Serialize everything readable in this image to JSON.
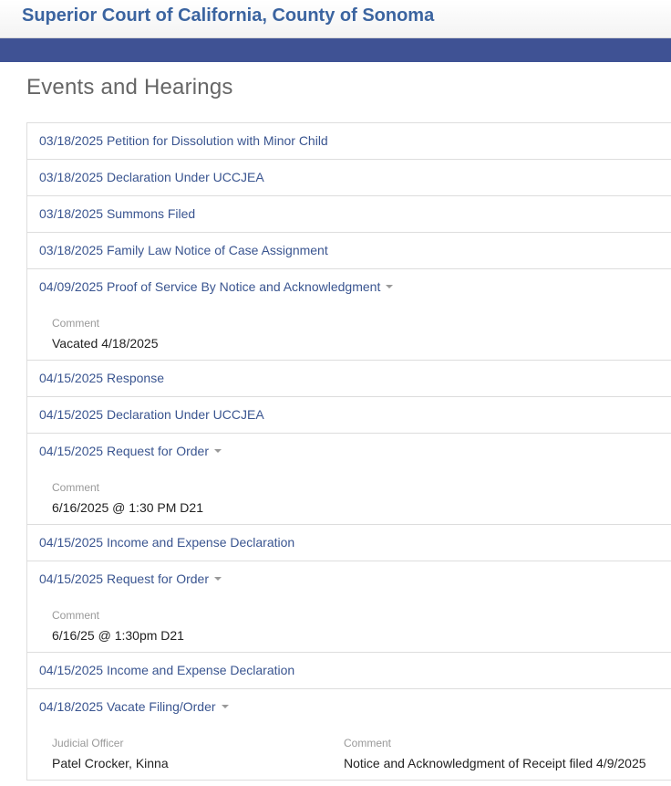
{
  "header": {
    "title": "Superior Court of California, County of Sonoma"
  },
  "page": {
    "title": "Events and Hearings"
  },
  "events": [
    {
      "label": "03/18/2025 Petition for Dissolution with Minor Child"
    },
    {
      "label": "03/18/2025 Declaration Under UCCJEA"
    },
    {
      "label": "03/18/2025 Summons Filed"
    },
    {
      "label": "03/18/2025 Family Law Notice of Case Assignment"
    },
    {
      "label": "04/09/2025 Proof of Service By Notice and Acknowledgment",
      "comment_label": "Comment",
      "comment": "Vacated 4/18/2025"
    },
    {
      "label": "04/15/2025 Response"
    },
    {
      "label": "04/15/2025 Declaration Under UCCJEA"
    },
    {
      "label": "04/15/2025 Request for Order",
      "comment_label": "Comment",
      "comment": "6/16/2025 @ 1:30 PM D21"
    },
    {
      "label": "04/15/2025 Income and Expense Declaration"
    },
    {
      "label": "04/15/2025 Request for Order",
      "comment_label": "Comment",
      "comment": "6/16/25 @ 1:30pm D21"
    },
    {
      "label": "04/15/2025 Income and Expense Declaration"
    },
    {
      "label": "04/18/2025 Vacate Filing/Order",
      "officer_label": "Judicial Officer",
      "officer": "Patel Crocker, Kinna",
      "comment_label": "Comment",
      "comment": "Notice and Acknowledgment of Receipt filed 4/9/2025"
    }
  ]
}
